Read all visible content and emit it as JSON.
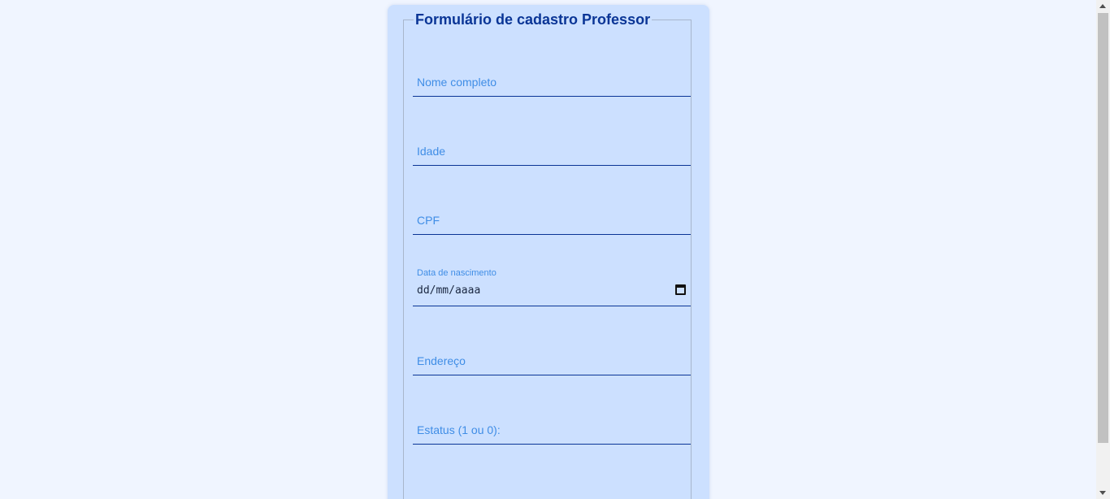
{
  "form": {
    "legend": "Formulário de cadastro Professor",
    "fields": [
      {
        "name": "nome",
        "placeholder": "Nome completo"
      },
      {
        "name": "idade",
        "placeholder": "Idade"
      },
      {
        "name": "cpf",
        "placeholder": "CPF"
      },
      {
        "name": "data_nascimento",
        "label": "Data de nascimento",
        "value": "dd/mm/aaaa"
      },
      {
        "name": "endereco",
        "placeholder": "Endereço"
      },
      {
        "name": "estatus",
        "placeholder": "Estatus (1 ou 0):"
      }
    ]
  },
  "colors": {
    "page_background": "#f0f5ff",
    "card_background": "#cce0ff",
    "legend_text": "#0a3596",
    "placeholder_text": "#3f8de6",
    "field_underline": "#0a3596"
  }
}
